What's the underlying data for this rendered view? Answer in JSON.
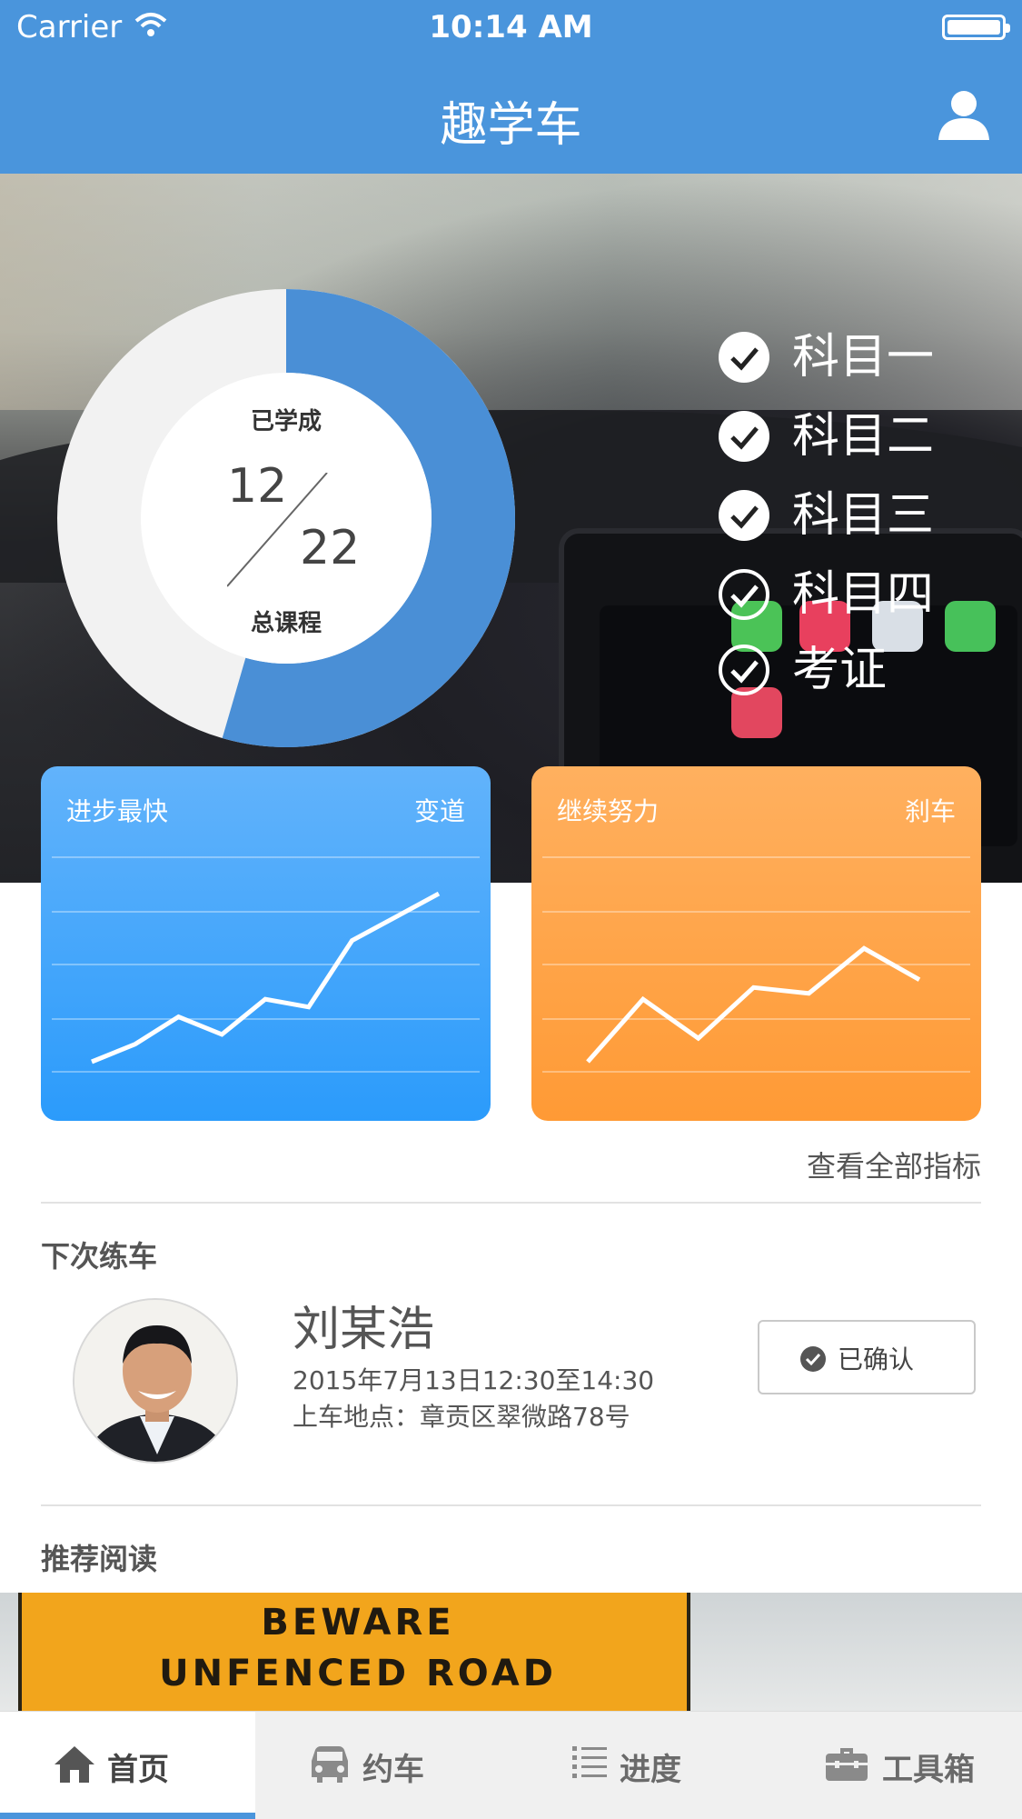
{
  "status_bar": {
    "carrier": "Carrier",
    "time": "10:14 AM"
  },
  "nav": {
    "title": "趣学车",
    "user_icon": "user-icon"
  },
  "progress": {
    "learned_label": "已学成",
    "learned": "12",
    "total": "22",
    "total_label": "总课程",
    "fraction": 0.545
  },
  "subjects": [
    {
      "label": "科目一",
      "done": true
    },
    {
      "label": "科目二",
      "done": true
    },
    {
      "label": "科目三",
      "done": true
    },
    {
      "label": "科目四",
      "done": false
    },
    {
      "label": "考证",
      "done": false
    }
  ],
  "cards": {
    "fastest": {
      "title": "进步最快",
      "tag": "变道",
      "color_top": "#62b3fb",
      "color_bottom": "#2b9bfb",
      "trend": [
        0.0,
        0.09,
        0.23,
        0.14,
        0.32,
        0.28,
        0.62,
        0.74,
        0.86
      ]
    },
    "keep_going": {
      "title": "继续努力",
      "tag": "刹车",
      "color_top": "#ffb05f",
      "color_bottom": "#ff9a35",
      "trend": [
        0.0,
        0.32,
        0.12,
        0.38,
        0.35,
        0.58,
        0.42
      ]
    }
  },
  "see_all": "查看全部指标",
  "next_practice": {
    "section_title": "下次练车",
    "coach_name": "刘某浩",
    "time": "2015年7月13日12:30至14:30",
    "place_label": "上车地点：",
    "place": "章贡区翠微路78号",
    "confirm_label": "已确认"
  },
  "reading": {
    "section_title": "推荐阅读",
    "sign_line1": "BEWARE",
    "sign_line2": "UNFENCED ROAD"
  },
  "tabs": [
    {
      "label": "首页",
      "icon": "home-icon",
      "active": true
    },
    {
      "label": "约车",
      "icon": "car-icon",
      "active": false
    },
    {
      "label": "进度",
      "icon": "list-icon",
      "active": false
    },
    {
      "label": "工具箱",
      "icon": "toolbox-icon",
      "active": false
    }
  ],
  "colors": {
    "primary": "#4a95dc",
    "donut_fill": "#4a8fd6",
    "donut_track": "#f2f2f2"
  }
}
